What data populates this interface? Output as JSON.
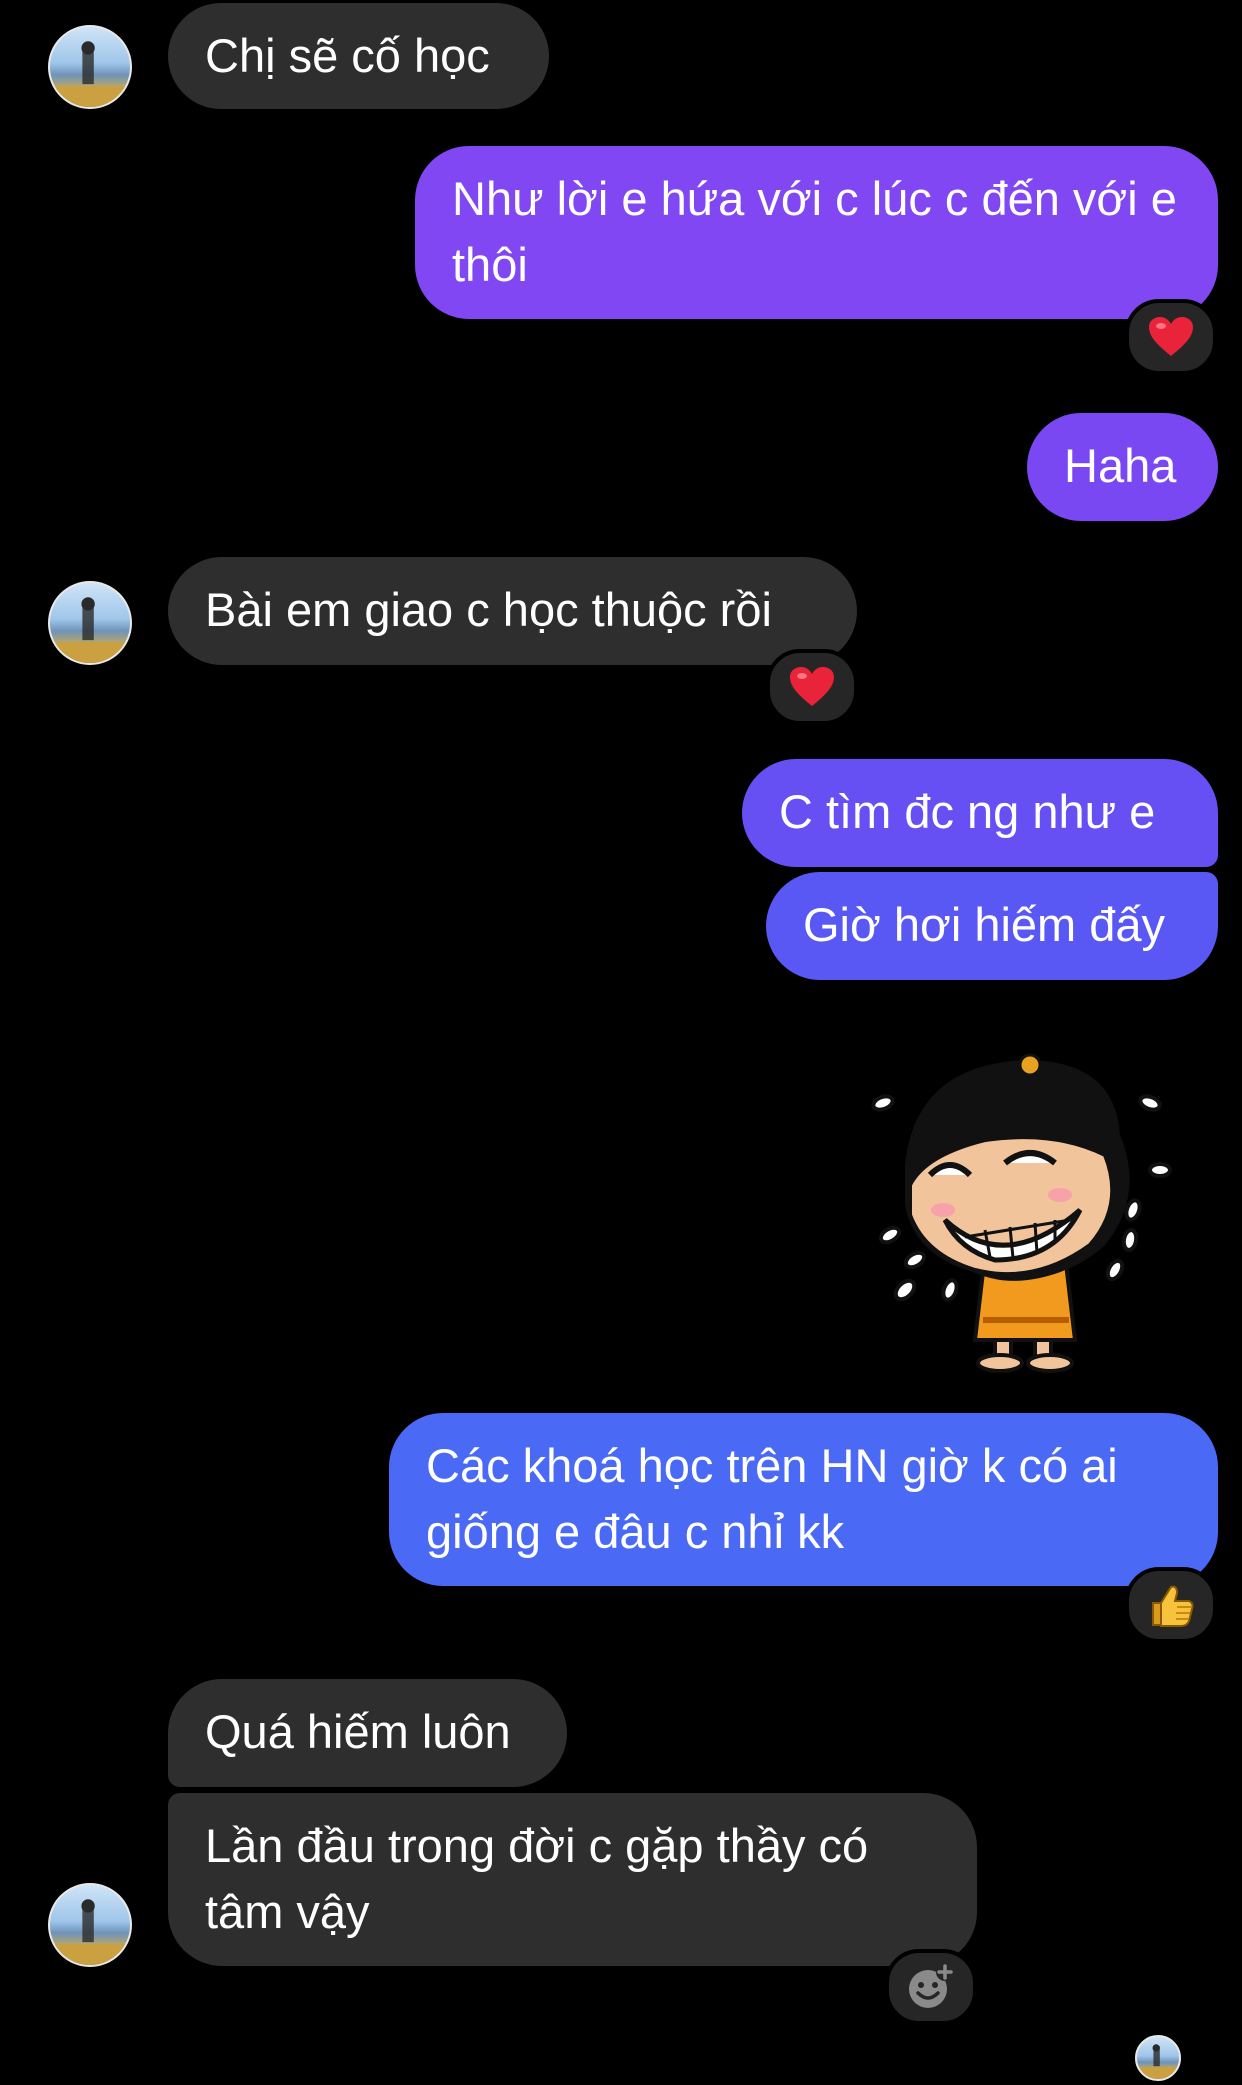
{
  "messages": [
    {
      "text": "Chị sẽ cố học",
      "sender": "them"
    },
    {
      "text": "Như lời e hứa với c lúc c đến với e thôi",
      "sender": "me",
      "reaction": "heart"
    },
    {
      "text": "Haha",
      "sender": "me"
    },
    {
      "text": "Bài em giao c học thuộc rồi",
      "sender": "them",
      "reaction": "heart"
    },
    {
      "text": "C tìm đc ng như e",
      "sender": "me"
    },
    {
      "text": "Giờ hơi hiếm đấy",
      "sender": "me"
    },
    {
      "sticker": "laughing-crying-cartoon-kid",
      "sender": "me"
    },
    {
      "text": "Các khoá học trên HN giờ k có ai giống e đâu c nhỉ kk",
      "sender": "me",
      "reaction": "thumbs-up"
    },
    {
      "text": "Quá hiếm luôn",
      "sender": "them"
    },
    {
      "text": "Lần đầu trong đời c gặp thầy có tâm vậy",
      "sender": "them",
      "reaction_button": "add-reaction"
    }
  ],
  "colors": {
    "background": "#000000",
    "incoming_bubble": "#2e2e2e",
    "outgoing_gradient_top": "#8a44f2",
    "outgoing_gradient_bottom": "#4a69f5",
    "heart": "#e8233a",
    "thumbs_up": "#f7c23c"
  }
}
